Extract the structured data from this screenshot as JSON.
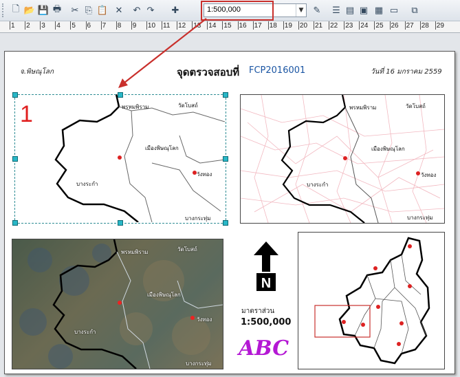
{
  "toolbar": {
    "scale_value": "1:500,000",
    "buttons": [
      {
        "name": "new-document-icon",
        "glyph": "🗋"
      },
      {
        "name": "open-folder-icon",
        "glyph": "📂"
      },
      {
        "name": "save-icon",
        "glyph": "💾"
      },
      {
        "name": "print-icon",
        "glyph": "🖶"
      },
      {
        "name": "cut-icon",
        "glyph": "✂"
      },
      {
        "name": "copy-icon",
        "glyph": "⎘"
      },
      {
        "name": "paste-icon",
        "glyph": "📋"
      },
      {
        "name": "delete-icon",
        "glyph": "✕"
      },
      {
        "name": "undo-icon",
        "glyph": "↶"
      },
      {
        "name": "redo-icon",
        "glyph": "↷"
      },
      {
        "name": "add-data-icon",
        "glyph": "✚"
      }
    ],
    "right_buttons": [
      {
        "name": "editor-icon",
        "glyph": "✎"
      },
      {
        "name": "table-of-contents-icon",
        "glyph": "☰"
      },
      {
        "name": "catalog-icon",
        "glyph": "▤"
      },
      {
        "name": "search-window-icon",
        "glyph": "▣"
      },
      {
        "name": "arctoolbox-icon",
        "glyph": "▦"
      },
      {
        "name": "python-window-icon",
        "glyph": "▭"
      },
      {
        "name": "model-builder-icon",
        "glyph": "⧉"
      }
    ]
  },
  "ruler": {
    "ticks": [
      "1",
      "2",
      "3",
      "4",
      "5",
      "6",
      "7",
      "8",
      "9",
      "10",
      "11",
      "12",
      "13",
      "14",
      "15",
      "16",
      "17",
      "18",
      "19",
      "20",
      "21",
      "22",
      "23",
      "24",
      "25",
      "26",
      "27",
      "28",
      "29"
    ]
  },
  "layout": {
    "province": "จ.พิษณุโลก",
    "title": "จุดตรวจสอบที่",
    "code": "FCP2016001",
    "date": "วันที่ 16 มกราคม 2559",
    "frame_number": "1",
    "scale_label": "มาตราส่วน",
    "scale_value": "1:500,000",
    "logo_text": "ABC"
  },
  "map_labels": {
    "nakhon_thai_top": "พรหมพิราม",
    "wat_bot": "วัดโบสถ์",
    "mueang": "เมืองพิษณุโลก",
    "bang_krathum": "บางกระทุ่ม",
    "wang_thong": "วังทอง",
    "bang_rakam": "บางระกำ",
    "bang_krathum2": "บางกระทุ่ม"
  },
  "colors": {
    "accent_red": "#c9302c",
    "selection": "#29b7c7",
    "logo": "#b418d4",
    "code": "#1a55a3"
  }
}
